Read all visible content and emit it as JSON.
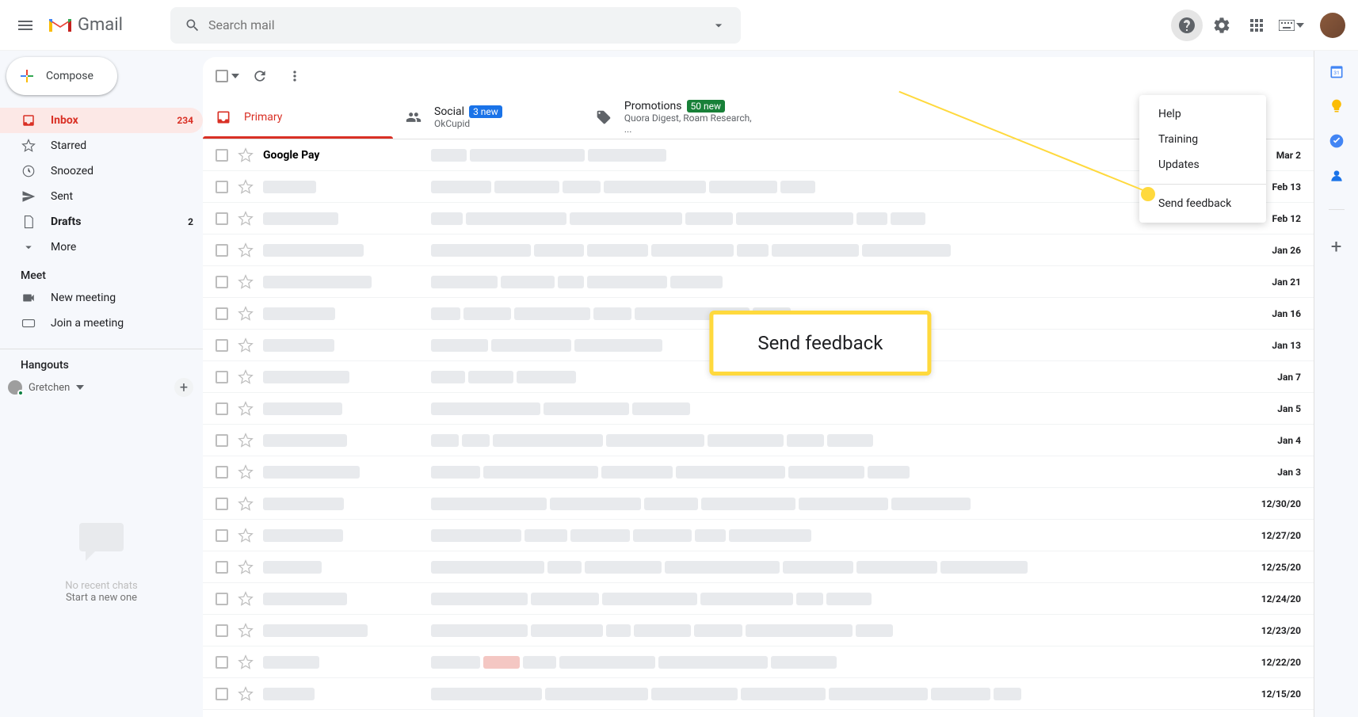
{
  "header": {
    "logo_text": "Gmail",
    "search_placeholder": "Search mail"
  },
  "compose_label": "Compose",
  "sidebar": {
    "items": [
      {
        "label": "Inbox",
        "count": "234",
        "icon": "inbox"
      },
      {
        "label": "Starred",
        "count": "",
        "icon": "star"
      },
      {
        "label": "Snoozed",
        "count": "",
        "icon": "clock"
      },
      {
        "label": "Sent",
        "count": "",
        "icon": "send"
      },
      {
        "label": "Drafts",
        "count": "2",
        "icon": "file"
      },
      {
        "label": "More",
        "count": "",
        "icon": "chevron-down"
      }
    ],
    "meet_header": "Meet",
    "meet_items": [
      {
        "label": "New meeting"
      },
      {
        "label": "Join a meeting"
      }
    ],
    "hangouts_header": "Hangouts",
    "hangouts_user": "Gretchen",
    "no_chats": "No recent chats",
    "start_chat": "Start a new one"
  },
  "tabs": [
    {
      "label": "Primary",
      "badge": "",
      "sub": ""
    },
    {
      "label": "Social",
      "badge": "3 new",
      "sub": "OkCupid"
    },
    {
      "label": "Promotions",
      "badge": "50 new",
      "sub": "Quora Digest, Roam Research, ..."
    }
  ],
  "settings_menu": {
    "items": [
      {
        "label": "Help"
      },
      {
        "label": "Training"
      },
      {
        "label": "Updates"
      },
      {
        "label": "Send feedback"
      }
    ]
  },
  "callout_text": "Send feedback",
  "emails": [
    {
      "sender": "Google Pay",
      "date": "Mar 2",
      "unread": true
    },
    {
      "sender": "",
      "date": "Feb 13",
      "unread": true
    },
    {
      "sender": "",
      "date": "Feb 12",
      "unread": true
    },
    {
      "sender": "",
      "date": "Jan 26",
      "unread": true
    },
    {
      "sender": "",
      "date": "Jan 21",
      "unread": true
    },
    {
      "sender": "",
      "date": "Jan 16",
      "unread": true
    },
    {
      "sender": "",
      "date": "Jan 13",
      "unread": true
    },
    {
      "sender": "",
      "date": "Jan 7",
      "unread": true
    },
    {
      "sender": "",
      "date": "Jan 5",
      "unread": true
    },
    {
      "sender": "",
      "date": "Jan 4",
      "unread": true
    },
    {
      "sender": "",
      "date": "Jan 3",
      "unread": true
    },
    {
      "sender": "",
      "date": "12/30/20",
      "unread": true
    },
    {
      "sender": "",
      "date": "12/27/20",
      "unread": true
    },
    {
      "sender": "",
      "date": "12/25/20",
      "unread": true
    },
    {
      "sender": "",
      "date": "12/24/20",
      "unread": true
    },
    {
      "sender": "",
      "date": "12/23/20",
      "unread": true
    },
    {
      "sender": "",
      "date": "12/22/20",
      "unread": true
    },
    {
      "sender": "",
      "date": "12/15/20",
      "unread": true
    }
  ]
}
